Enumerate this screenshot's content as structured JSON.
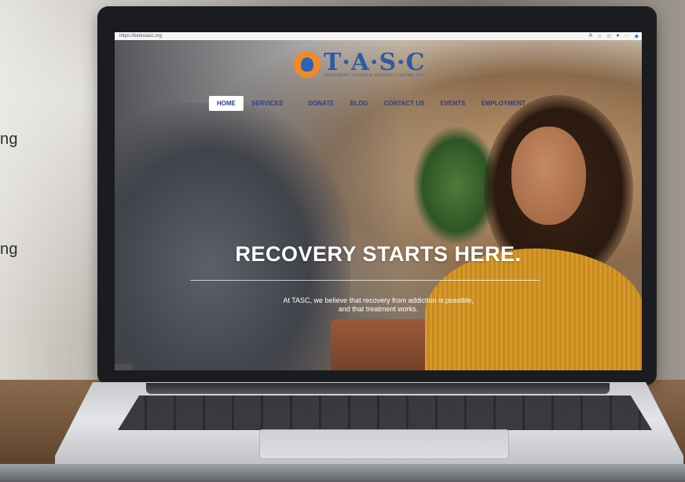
{
  "background": {
    "side_text": [
      "ng",
      "ng"
    ]
  },
  "browser": {
    "url": "https://berkstasc.org",
    "icons": [
      "read-aloud-icon",
      "favorite-icon",
      "collections-icon",
      "profile-icon",
      "more-icon",
      "copilot-icon"
    ]
  },
  "site": {
    "logo_text": "T·A·S·C",
    "logo_subtitle": "TREATMENT ACCESS & SERVICES CENTER, INC.",
    "nav": [
      {
        "label": "HOME",
        "active": true
      },
      {
        "label": "SERVICES",
        "active": false
      },
      {
        "label": "DONATE",
        "active": false
      },
      {
        "label": "BLOG",
        "active": false
      },
      {
        "label": "CONTACT US",
        "active": false
      },
      {
        "label": "EVENTS",
        "active": false
      },
      {
        "label": "EMPLOYMENT",
        "active": false
      }
    ],
    "headline": "RECOVERY STARTS HERE.",
    "tagline_line1": "At TASC, we believe that recovery from addiction is possible,",
    "tagline_line2": "and that treatment works."
  },
  "colors": {
    "brand_blue": "#2e5aa8",
    "brand_orange": "#f08a28",
    "nav_text": "#2b3f8a"
  }
}
